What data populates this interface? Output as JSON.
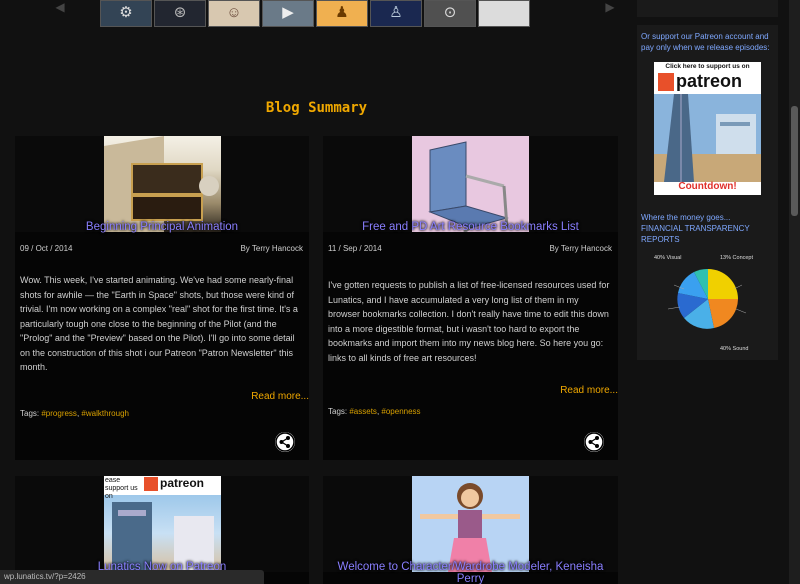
{
  "carousel": {
    "thumbnails": [
      {
        "name": "thumb-1",
        "bg": "#334455"
      },
      {
        "name": "thumb-2",
        "bg": "#222630"
      },
      {
        "name": "thumb-3",
        "bg": "#d8c8b0"
      },
      {
        "name": "thumb-4",
        "bg": "#6a7a88"
      },
      {
        "name": "thumb-5",
        "bg": "#f0b050"
      },
      {
        "name": "thumb-6",
        "bg": "#1a2850"
      },
      {
        "name": "thumb-7",
        "bg": "#505050"
      },
      {
        "name": "thumb-8",
        "bg": "#dcdcdc"
      }
    ]
  },
  "blog": {
    "title": "Blog Summary",
    "posts": [
      {
        "title": "Beginning Principal Animation",
        "date": "09 / Oct / 2014",
        "author_prefix": "By",
        "author": "Terry Hancock",
        "excerpt": "Wow. This week, I've started animating. We've had some nearly-final shots for awhile — the \"Earth in Space\" shots, but those were kind of trivial. I'm now working on a complex \"real\" shot for the first time. It's a particularly tough one close to the beginning of the Pilot (and the \"Prolog\" and the \"Preview\" based on the Pilot). I'll go into some detail on the construction of this shot i our Patreon \"Patron Newsletter\" this month.",
        "read_more": "Read more...",
        "tags_label": "Tags:",
        "tags": [
          "#progress",
          "#walkthrough"
        ]
      },
      {
        "title": "Free and PD Art Resource Bookmarks List",
        "date": "11 / Sep / 2014",
        "author_prefix": "By",
        "author": "Terry Hancock",
        "excerpt": "I've gotten requests to publish a list of free-licensed resources used for Lunatics, and I have accumulated a very long list of them in my browser bookmarks collection. I don't really have time to edit this down into a more digestible format, but i wasn't too hard to export the bookmarks and import them into my news blog here. So here you go: links to all kinds of free art resources!",
        "read_more": "Read more...",
        "tags_label": "Tags:",
        "tags": [
          "#assets",
          "#openness"
        ]
      },
      {
        "title": "Lunatics Now on Patreon",
        "patreon_banner": "ease support us on",
        "patreon_logo": "patreon"
      },
      {
        "title": "Welcome to Character/Wardrobe Modeler, Keneisha Perry"
      }
    ]
  },
  "sidebar": {
    "support_text": "Or support our Patreon account and pay only when we release episodes:",
    "patreon_ad": {
      "header": "Click here to support us on",
      "logo": "patreon",
      "footer": "Countdown!"
    },
    "money_text": "Where the money goes... FINANCIAL TRANSPARENCY REPORTS",
    "pie": {
      "label_visual": "40% Visual",
      "label_concept": "13% Concept",
      "label_sound": "40% Sound"
    }
  },
  "status_bar": {
    "url": "wp.lunatics.tv/?p=2426"
  },
  "colors": {
    "accent_orange": "#f0a800",
    "title_purple": "#8a7fff",
    "link_blue": "#7fa8ff",
    "patreon_orange": "#e8502a"
  },
  "icons": {
    "carousel_prev": "chevron-left-icon",
    "carousel_next": "chevron-right-icon",
    "share": "share-icon"
  }
}
